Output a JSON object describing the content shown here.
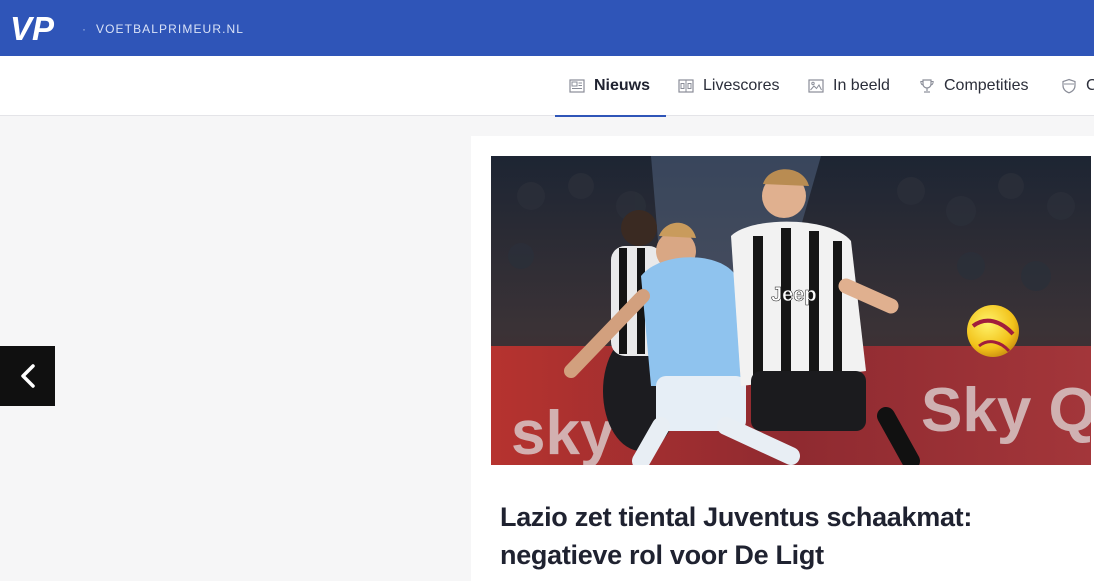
{
  "header": {
    "logo_text": "VP",
    "separator": "·",
    "site_name": "VOETBALPRIMEUR.NL"
  },
  "nav": {
    "items": [
      {
        "label": "Nieuws",
        "icon": "newspaper-icon",
        "active": true
      },
      {
        "label": "Livescores",
        "icon": "scoreboard-icon",
        "active": false
      },
      {
        "label": "In beeld",
        "icon": "image-icon",
        "active": false
      },
      {
        "label": "Competities",
        "icon": "trophy-icon",
        "active": false
      },
      {
        "label": "C",
        "icon": "shield-icon",
        "active": false
      }
    ]
  },
  "article": {
    "image_alt": "Lazio vs Juventus football match",
    "title": "Lazio zet tiental Juventus schaakmat: negatieve rol voor De Ligt"
  },
  "colors": {
    "brand_blue": "#2f55b8",
    "text_dark": "#1f2230",
    "page_bg": "#f6f6f7"
  }
}
